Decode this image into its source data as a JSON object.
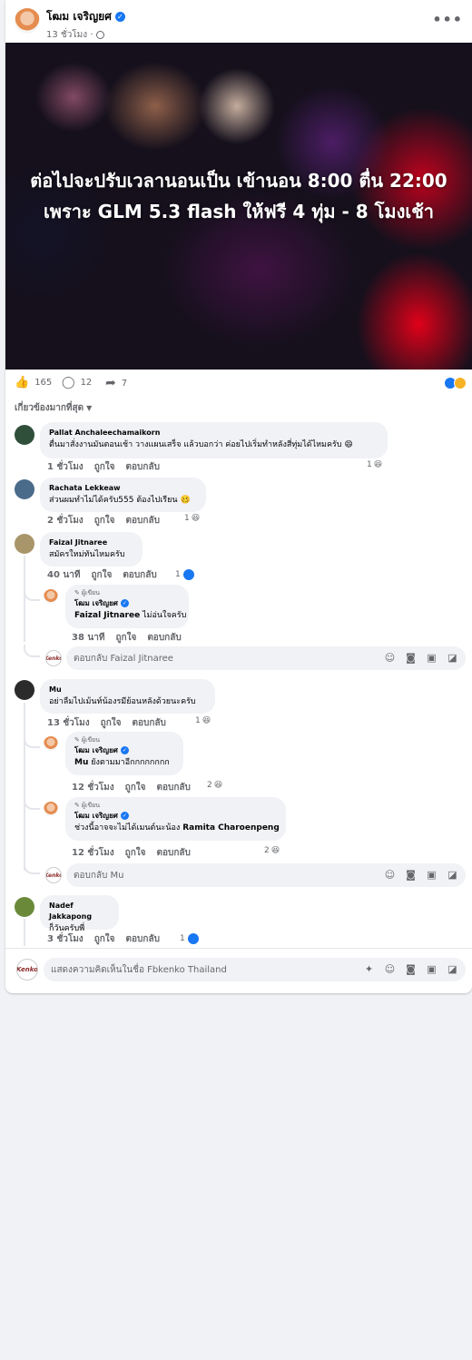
{
  "post": {
    "author": "โฒม เจริญยศ",
    "meta_time": "13 ชั่วโมง ·",
    "image_text": "ต่อไปจะปรับเวลานอนเป็น เข้านอน 8:00 ตื่น 22:00 เพราะ GLM 5.3 flash ให้ฟรี 4 ทุ่ม - 8 โมงเช้า",
    "likes": "165",
    "comments": "12",
    "shares": "7",
    "sort_label": "เกี่ยวข้องมากที่สุด"
  },
  "icons": {
    "verified": "verified-badge-icon",
    "globe": "globe-icon",
    "more": "more-options-icon",
    "like": "like-icon",
    "comment": "comment-icon",
    "share": "share-icon"
  },
  "colors": {
    "accent": "#1877f2",
    "haha": "#f7b125",
    "bubble": "#f0f2f5"
  },
  "labels": {
    "like": "ถูกใจ",
    "reply": "ตอบกลับ",
    "author_tag": "ผู้เขียน",
    "verified_glyph": "✓",
    "more_glyph": "•••",
    "like_glyph": "👍",
    "comment_glyph": "◯",
    "share_glyph": "➦",
    "haha_glyph": "😆",
    "smile_glyph": "😄",
    "avatar_brand": "Kenko"
  },
  "comments": [
    {
      "name": "Pallat Anchaleechamaikorn",
      "text": "ตื่นมาสั่งงานมันตอนเช้า วางแผนเสร็จ แล้วบอกว่า ค่อยไปเริ่มทำหลังสี่ทุ่มได้ไหมครับ",
      "time": "1 ชั่วโมง",
      "count": "1"
    },
    {
      "name": "Rachata Lekkeaw",
      "text": "ส่วนผมทำไม่ได้ครับ555 ต้องไปเรียน",
      "time": "2 ชั่วโมง",
      "count": "1"
    },
    {
      "name": "Faizal Jitnaree",
      "text": "สมัครใหม่ทันไหมครับ",
      "time": "40 นาที",
      "count": "1",
      "reply": {
        "name": "โฒม เจริญยศ",
        "mention": "Faizal Jitnaree",
        "text": " ไม่อ่นใจครับ",
        "time": "38 นาที"
      },
      "reply_placeholder": "ตอบกลับ Faizal Jitnaree"
    },
    {
      "name": "Mu",
      "text": "อย่าลืมไปเม้นท์น้องรมีย้อนหลังด้วยนะครับ",
      "time": "13 ชั่วโมง",
      "count": "1",
      "replies": [
        {
          "name": "โฒม เจริญยศ",
          "mention": "Mu",
          "text": " ยังตามมาอีกกกกกกกก",
          "time": "12 ชั่วโมง",
          "count": "2"
        },
        {
          "name": "โฒม เจริญยศ",
          "text": "ช่วงนี้อาจจะไม่ได้เมนต์นะน้อง ",
          "mention": "Ramita Charoenpeng",
          "time": "12 ชั่วโมง",
          "count": "2"
        }
      ],
      "reply_placeholder": "ตอบกลับ Mu"
    },
    {
      "name": "Nadef Jakkapong",
      "text": "ก็วันครับพี่",
      "time": "3 ชั่วโมง",
      "count": "1"
    }
  ],
  "composer": {
    "placeholder": "แสดงความคิดเห็นในชื่อ Fbkenko Thailand"
  }
}
